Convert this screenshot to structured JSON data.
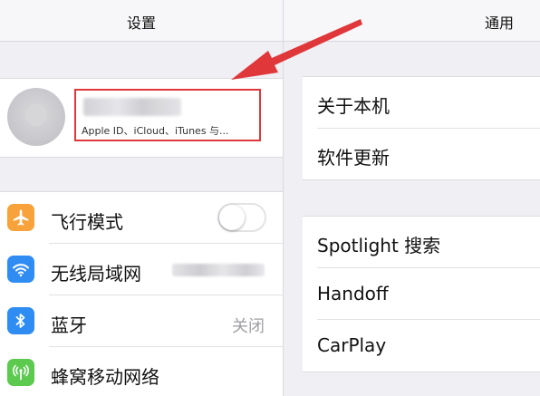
{
  "left": {
    "title": "设置",
    "profile": {
      "subtitle": "Apple ID、iCloud、iTunes 与..."
    },
    "items": [
      {
        "label": "飞行模式",
        "icon": "airplane-icon",
        "color": "#f7a23a",
        "toggle": "off"
      },
      {
        "label": "无线局域网",
        "icon": "wifi-icon",
        "color": "#2f8cf3"
      },
      {
        "label": "蓝牙",
        "icon": "bluetooth-icon",
        "color": "#2f8cf3",
        "value": "关闭"
      },
      {
        "label": "蜂窝移动网络",
        "icon": "cellular-icon",
        "color": "#5cc94f"
      }
    ]
  },
  "right": {
    "title": "通用",
    "group1": [
      {
        "label": "关于本机"
      },
      {
        "label": "软件更新"
      }
    ],
    "group2": [
      {
        "label": "Spotlight 搜索"
      },
      {
        "label": "Handoff"
      },
      {
        "label": "CarPlay"
      }
    ]
  },
  "annotation": {
    "highlight_color": "#e0373a"
  }
}
